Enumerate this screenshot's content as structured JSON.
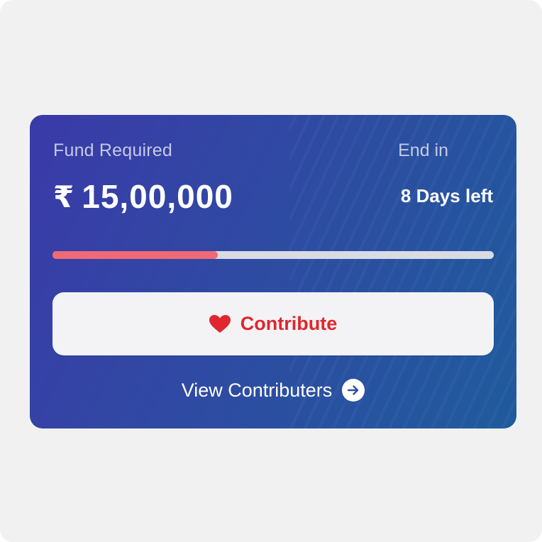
{
  "fund": {
    "label": "Fund Required",
    "currency_symbol": "₹",
    "amount": "15,00,000"
  },
  "deadline": {
    "label": "End in",
    "value": "8 Days left"
  },
  "progress": {
    "fraction": 0.375,
    "fill_color": "#f06a75",
    "track_color": "#d9dbe3"
  },
  "actions": {
    "contribute_label": "Contribute",
    "contribute_icon": "heart-icon",
    "view_label": "View Contributers",
    "view_icon": "arrow-right-circle-icon"
  },
  "colors": {
    "card_gradient_start": "#3a3aa8",
    "card_gradient_end": "#1f5b9c",
    "accent_red": "#e0262e"
  }
}
